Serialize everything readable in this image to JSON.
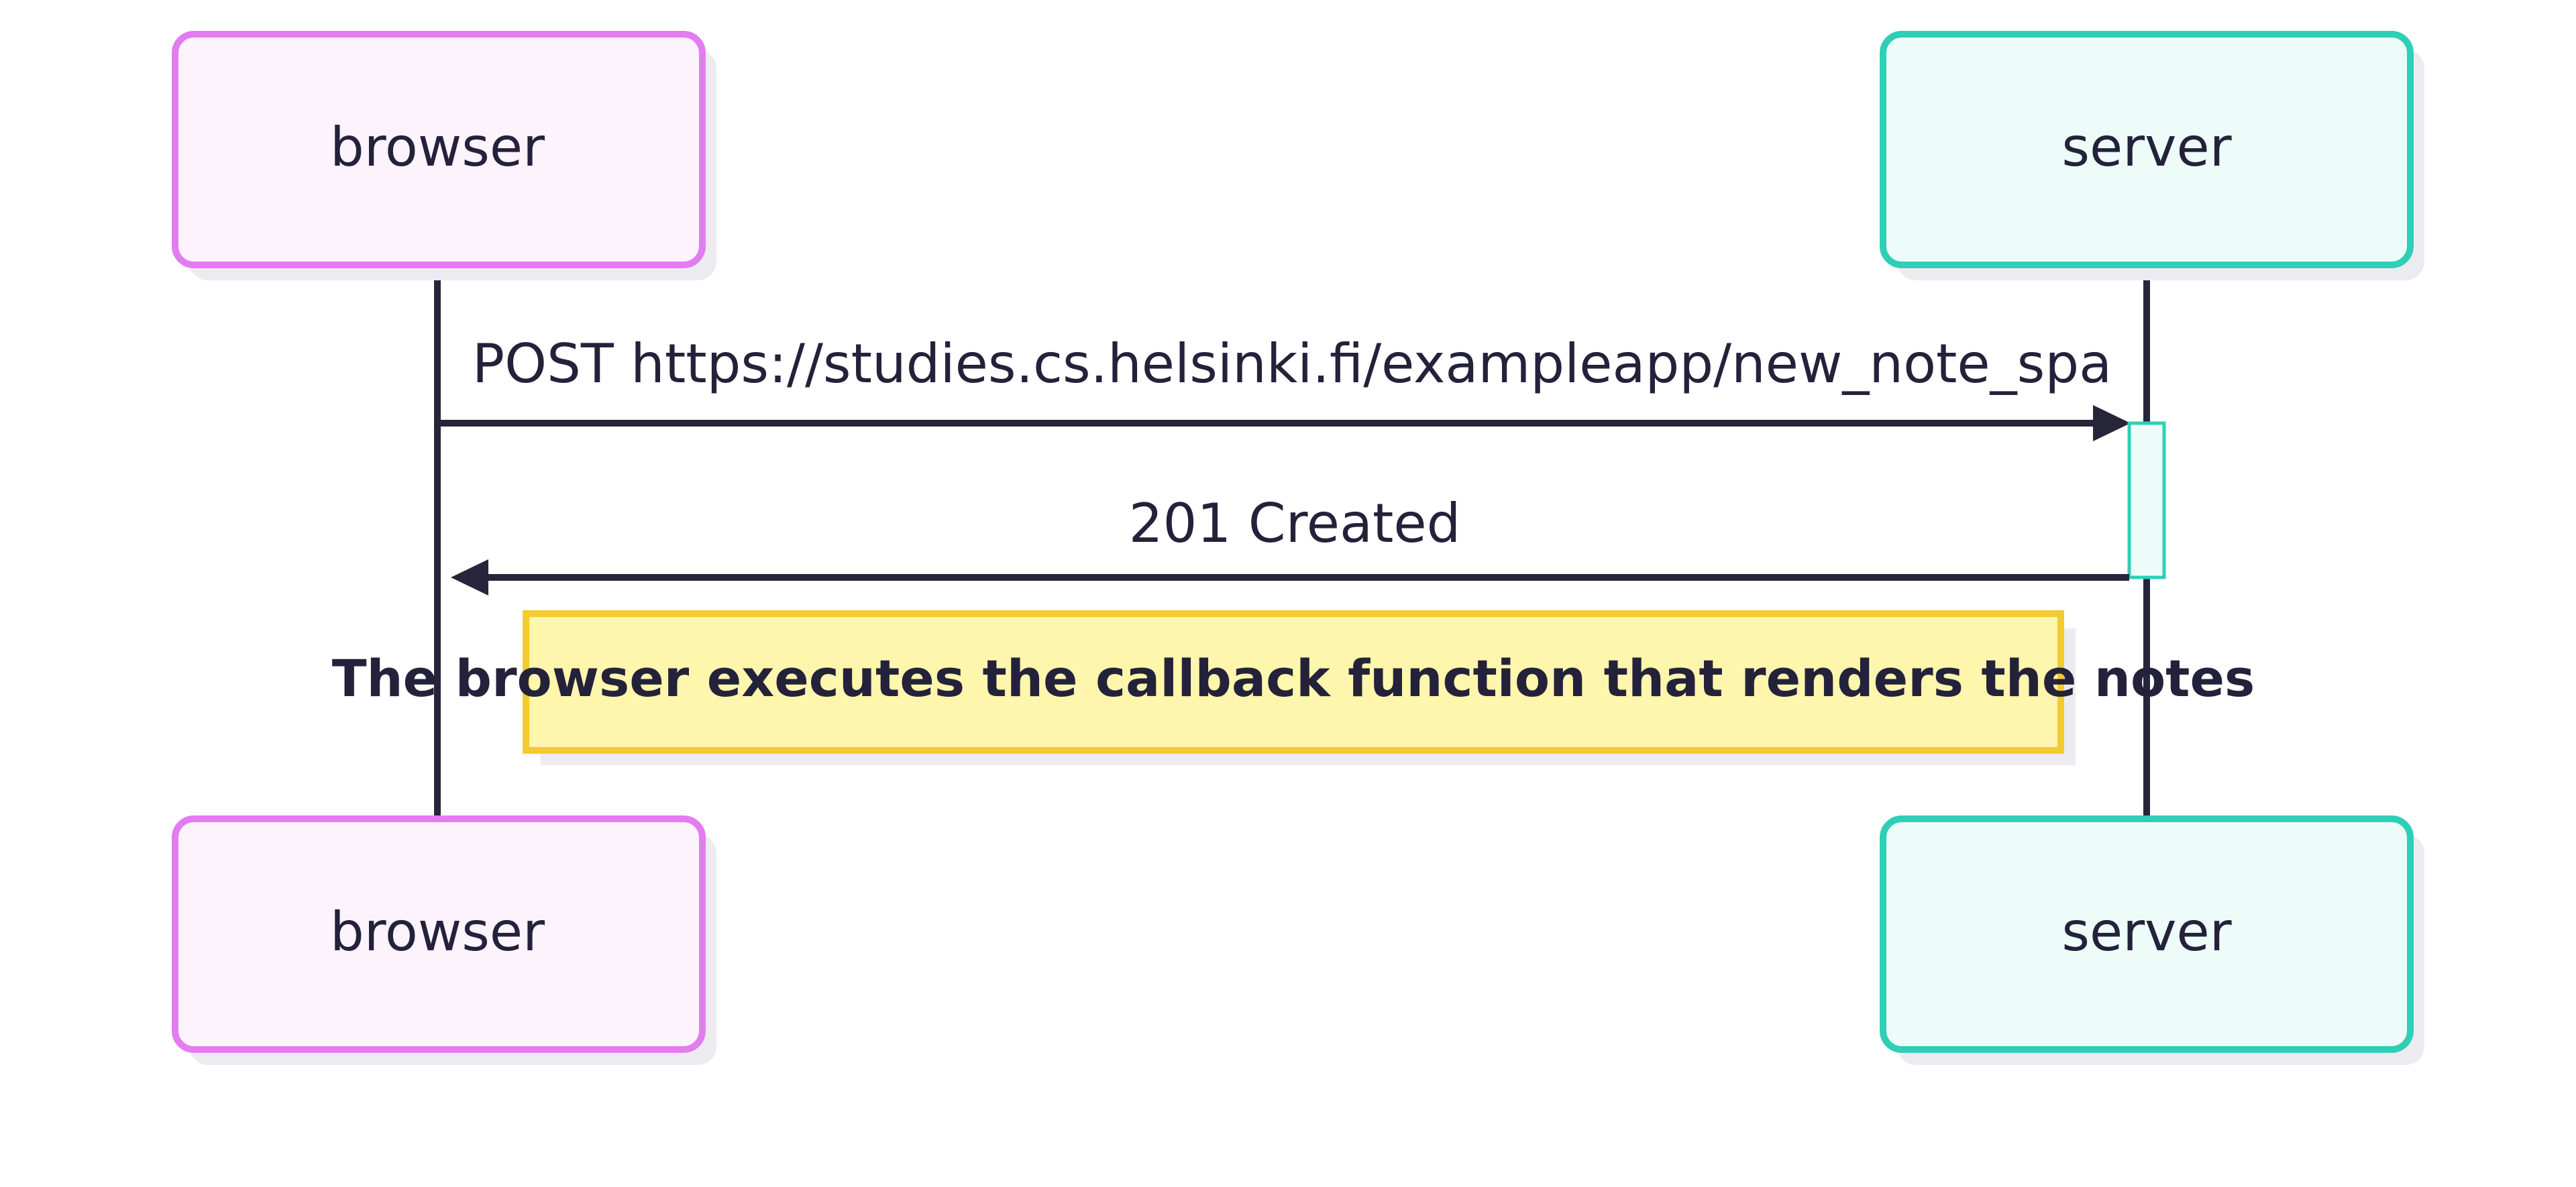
{
  "diagram": {
    "type": "sequence",
    "colors": {
      "browser_stroke": "#e27cf0",
      "browser_fill": "#fdf3fd",
      "server_stroke": "#2fcfb6",
      "server_fill": "#eefcf9",
      "line": "#27253a",
      "text": "#24223a",
      "note_fill": "#fff6ae",
      "note_stroke": "#f3cb2e",
      "shadow": "#ececf0"
    },
    "participants": [
      {
        "id": "browser",
        "label": "browser"
      },
      {
        "id": "server",
        "label": "server"
      }
    ],
    "messages": [
      {
        "from": "browser",
        "to": "server",
        "label": "POST https://studies.cs.helsinki.fi/exampleapp/new_note_spa"
      },
      {
        "from": "server",
        "to": "browser",
        "label": "201 Created"
      }
    ],
    "note": {
      "text": "The browser executes the callback function that renders the notes"
    }
  }
}
